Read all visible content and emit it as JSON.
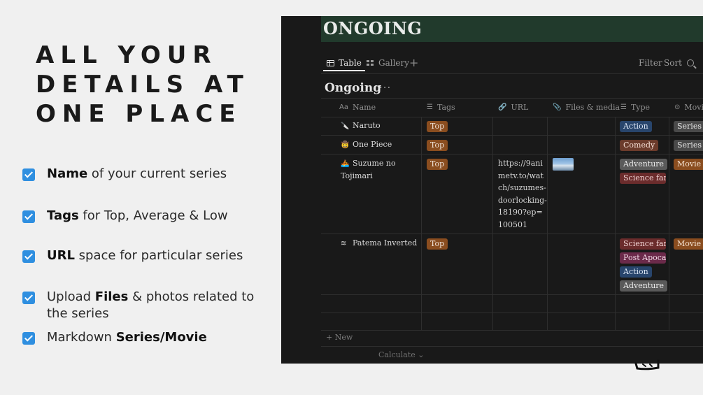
{
  "headline": [
    "ALL YOUR",
    "DETAILS AT",
    "ONE PLACE"
  ],
  "features": [
    {
      "pre": "",
      "bold": "Name",
      "post": " of your current series"
    },
    {
      "pre": "",
      "bold": "Tags",
      "post": " for Top, Average & Low"
    },
    {
      "pre": "",
      "bold": "URL",
      "post": " space for particular series"
    },
    {
      "pre": "Upload ",
      "bold": "Files",
      "post": " & photos related to the series"
    },
    {
      "pre": "Markdown ",
      "bold": "Series/Movie",
      "post": ""
    }
  ],
  "app": {
    "banner_title": "ONGOING",
    "tabs": {
      "table": "Table",
      "gallery": "Gallery",
      "add": "+"
    },
    "toolbar": {
      "filter": "Filter",
      "sort": "Sort"
    },
    "db_title": "Ongoing",
    "db_more": "···",
    "columns": {
      "name": "Name",
      "name_icon": "Aa",
      "tags": "Tags",
      "url": "URL",
      "files": "Files & media",
      "type": "Type",
      "movie": "Movi"
    },
    "rows": [
      {
        "icon": "🔪",
        "name": "Naruto",
        "tag": "Top",
        "url": "",
        "types": [
          "Action"
        ],
        "kind": "Series"
      },
      {
        "icon": "🤠",
        "name": "One Piece",
        "tag": "Top",
        "url": "",
        "types": [
          "Comedy"
        ],
        "kind": "Series"
      },
      {
        "icon": "🚣",
        "name": "Suzume no Tojimari",
        "tag": "Top",
        "url": "https://9animetv.to/watch/suzumes-doorlocking-18190?ep=100501",
        "types": [
          "Adventure",
          "Science fanta"
        ],
        "kind": "Movie"
      },
      {
        "icon": "≋",
        "name": "Patema Inverted",
        "tag": "Top",
        "url": "",
        "types": [
          "Science fanta",
          "Post Apocal",
          "Action",
          "Adventure"
        ],
        "kind": "Movie"
      }
    ],
    "new_label": "+ New",
    "calculate_label": "Calculate ⌄"
  }
}
